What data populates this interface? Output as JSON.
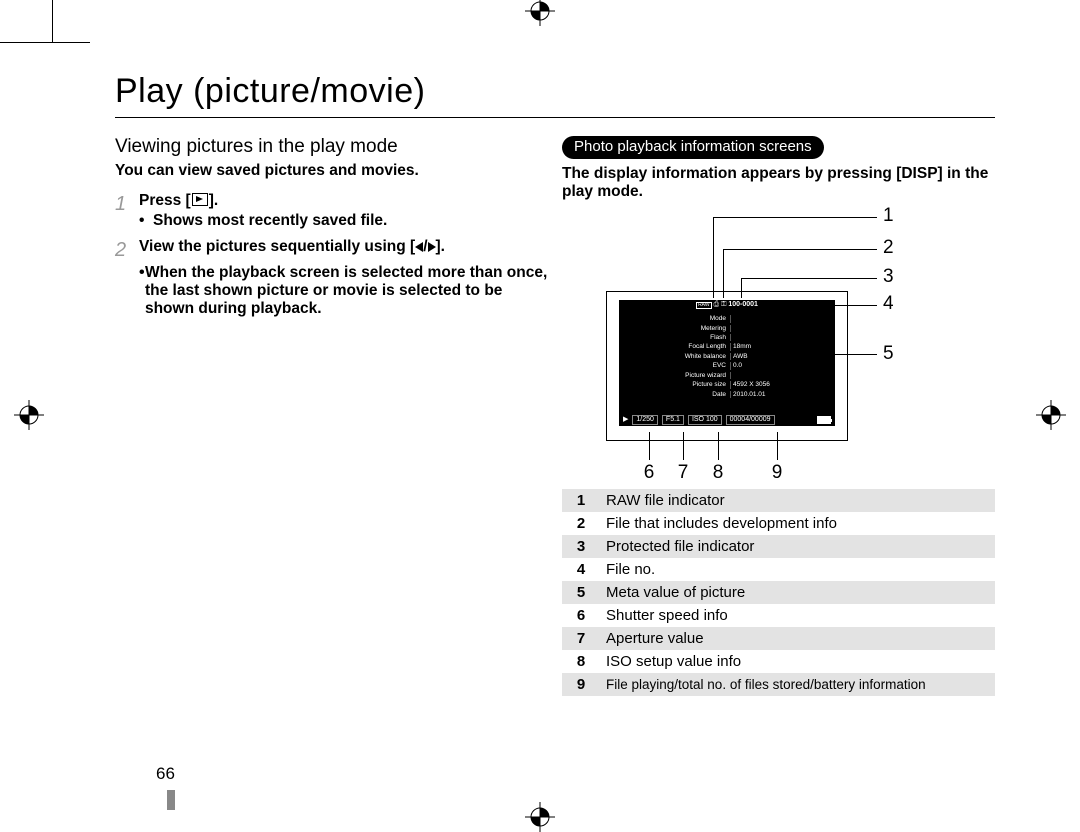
{
  "page_title": "Play (picture/movie)",
  "page_number": "66",
  "left": {
    "subhead": "Viewing pictures in the play mode",
    "intro": "You can view saved pictures and movies.",
    "step1_num": "1",
    "step1_press_prefix": "Press [",
    "step1_press_suffix": "].",
    "step1_bullet": "Shows most recently saved file.",
    "step2_num": "2",
    "step2_text_prefix": "View the pictures sequentially using [",
    "step2_text_sep": "/",
    "step2_text_suffix": "].",
    "step2_bullet": "When the playback screen is selected more than once, the last shown picture or movie is selected to be shown during playback."
  },
  "right": {
    "pill": "Photo playback information screens",
    "intro": "The display information appears by pressing [DISP] in the play mode.",
    "legend": [
      {
        "n": "1",
        "t": "RAW file indicator"
      },
      {
        "n": "2",
        "t": "File that includes development info"
      },
      {
        "n": "3",
        "t": "Protected file indicator"
      },
      {
        "n": "4",
        "t": "File no."
      },
      {
        "n": "5",
        "t": "Meta value of picture"
      },
      {
        "n": "6",
        "t": "Shutter speed info"
      },
      {
        "n": "7",
        "t": "Aperture value"
      },
      {
        "n": "8",
        "t": "ISO setup value info"
      },
      {
        "n": "9",
        "t": "File playing/total no. of files stored/battery information"
      }
    ],
    "display": {
      "top_raw": "RAW",
      "top_fileno": "100-0001",
      "meta_rows": [
        {
          "lbl": "Mode",
          "val": ""
        },
        {
          "lbl": "Metering",
          "val": ""
        },
        {
          "lbl": "Flash",
          "val": ""
        },
        {
          "lbl": "Focal Length",
          "val": "18mm"
        },
        {
          "lbl": "White balance",
          "val": "AWB"
        },
        {
          "lbl": "EVC",
          "val": "0.0"
        },
        {
          "lbl": "Picture wizard",
          "val": ""
        },
        {
          "lbl": "Picture size",
          "val": "4592 X 3056"
        },
        {
          "lbl": "Date",
          "val": "2010.01.01"
        }
      ],
      "bottom": {
        "shutter": "1/250",
        "aperture": "F5.1",
        "iso": "ISO  100",
        "counter": "00004/00009"
      }
    },
    "callout_labels": {
      "c1": "1",
      "c2": "2",
      "c3": "3",
      "c4": "4",
      "c5": "5",
      "c6": "6",
      "c7": "7",
      "c8": "8",
      "c9": "9"
    }
  }
}
